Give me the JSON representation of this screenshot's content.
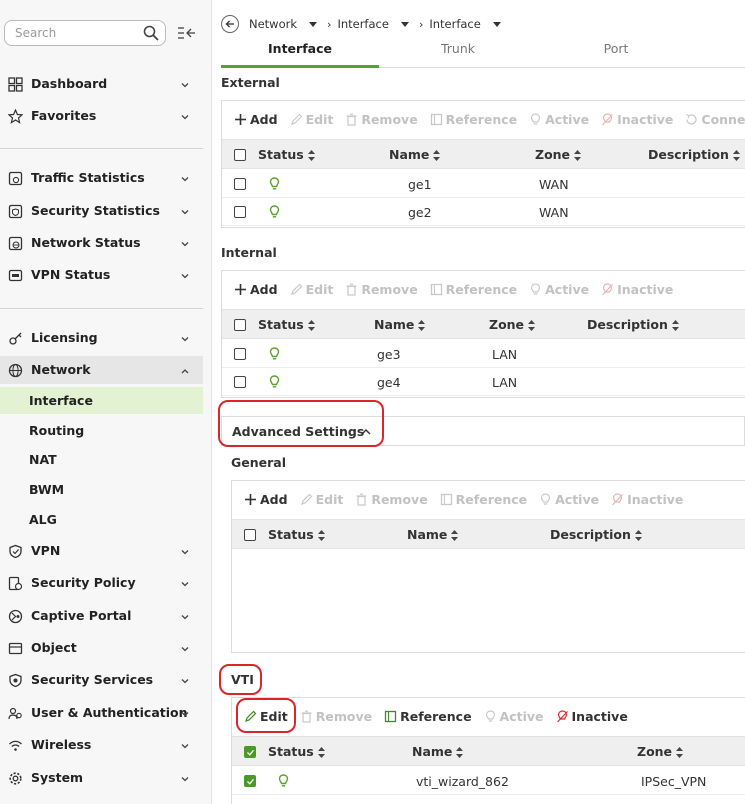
{
  "sidebar": {
    "search_placeholder": "Search",
    "items": [
      {
        "label": "Dashboard"
      },
      {
        "label": "Favorites"
      },
      {
        "label": "Traffic Statistics"
      },
      {
        "label": "Security Statistics"
      },
      {
        "label": "Network Status"
      },
      {
        "label": "VPN Status"
      },
      {
        "label": "Licensing"
      },
      {
        "label": "Network"
      },
      {
        "label": "VPN"
      },
      {
        "label": "Security Policy"
      },
      {
        "label": "Captive Portal"
      },
      {
        "label": "Object"
      },
      {
        "label": "Security Services"
      },
      {
        "label": "User & Authentication"
      },
      {
        "label": "Wireless"
      },
      {
        "label": "System"
      }
    ],
    "network_sub": [
      "Interface",
      "Routing",
      "NAT",
      "BWM",
      "ALG"
    ]
  },
  "breadcrumb": [
    "Network",
    "Interface",
    "Interface"
  ],
  "tabs": [
    "Interface",
    "Trunk",
    "Port"
  ],
  "toolbar_labels": {
    "add": "Add",
    "edit": "Edit",
    "remove": "Remove",
    "reference": "Reference",
    "active": "Active",
    "inactive": "Inactive",
    "connect": "Connect"
  },
  "columns": {
    "status": "Status",
    "name": "Name",
    "zone": "Zone",
    "description": "Description"
  },
  "external": {
    "title": "External",
    "rows": [
      {
        "name": "ge1",
        "zone": "WAN"
      },
      {
        "name": "ge2",
        "zone": "WAN"
      }
    ]
  },
  "internal": {
    "title": "Internal",
    "rows": [
      {
        "name": "ge3",
        "zone": "LAN"
      },
      {
        "name": "ge4",
        "zone": "LAN"
      }
    ]
  },
  "advanced": {
    "label": "Advanced Settings"
  },
  "general": {
    "title": "General"
  },
  "vti": {
    "title": "VTI",
    "rows": [
      {
        "name": "vti_wizard_862",
        "zone": "IPSec_VPN",
        "checked": true
      }
    ]
  },
  "colors": {
    "accent": "#5aa02c",
    "annotation": "#d9262c",
    "inactive_icon": "#d9262c",
    "active_icon": "#5aa02c"
  },
  "icons": [
    "search-icon",
    "collapse-sidebar-icon",
    "back-arrow-icon",
    "plus-icon",
    "pencil-icon",
    "trash-icon",
    "reference-icon",
    "bulb-icon",
    "inactive-bulb-icon",
    "connect-icon",
    "sort-icon",
    "chevron-down-icon",
    "chevron-up-icon"
  ]
}
